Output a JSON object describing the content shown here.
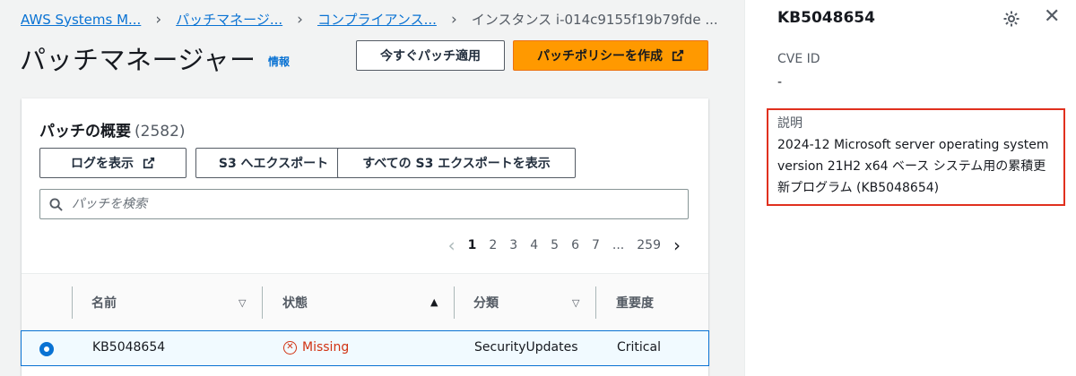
{
  "breadcrumb": {
    "items": [
      "AWS Systems M...",
      "パッチマネージ...",
      "コンプライアンス..."
    ],
    "current": "インスタンス i-014c9155f19b79fde ..."
  },
  "page": {
    "title": "パッチマネージャー",
    "info_link": "情報",
    "apply_now_label": "今すぐパッチ適用",
    "create_policy_label": "パッチポリシーを作成"
  },
  "panel": {
    "title": "パッチの概要",
    "count": "(2582)",
    "view_logs_label": "ログを表示",
    "export_s3_label": "S3 へエクスポート",
    "view_all_exports_label": "すべての S3 エクスポートを表示",
    "search_placeholder": "パッチを検索"
  },
  "pagination": {
    "pages": [
      "1",
      "2",
      "3",
      "4",
      "5",
      "6",
      "7",
      "...",
      "259"
    ],
    "current_page": "1"
  },
  "table": {
    "columns": [
      "名前",
      "状態",
      "分類",
      "重要度"
    ],
    "rows": [
      {
        "name": "KB5048654",
        "status": "Missing",
        "classification": "SecurityUpdates",
        "severity": "Critical",
        "selected": true
      }
    ]
  },
  "side_panel": {
    "title": "KB5048654",
    "cve_label": "CVE ID",
    "cve_value": "-",
    "description_label": "説明",
    "description_line1": "2024-12 Microsoft server operating system",
    "description_line2": "version 21H2 x64 ベース システム用の累積更",
    "description_line3": "新プログラム (KB5048654)"
  },
  "colors": {
    "link": "#0972d3",
    "primary": "#ff9900",
    "error": "#d13212",
    "highlight": "#e0301e"
  }
}
